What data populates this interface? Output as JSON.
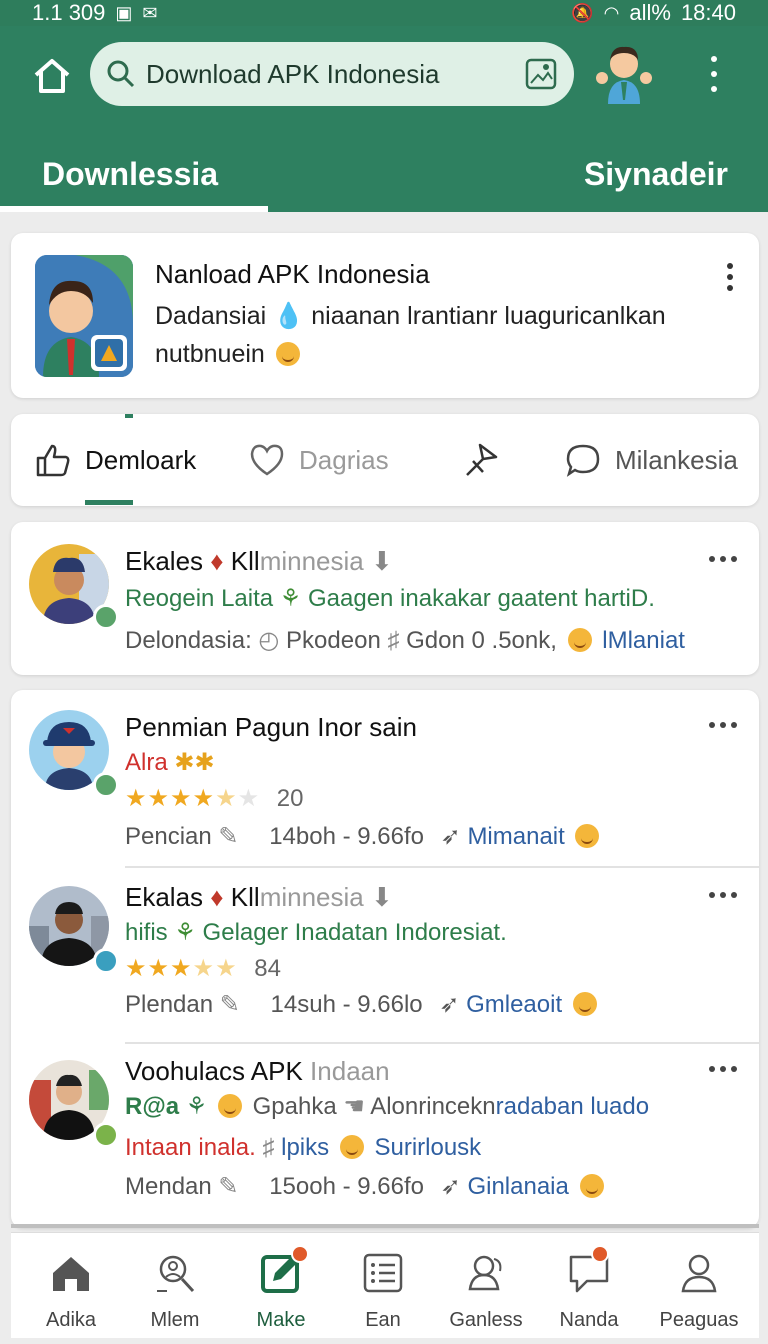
{
  "status_bar": {
    "left_text": "1.1 309",
    "time": "18:40",
    "signal_label": "all%"
  },
  "header": {
    "search_value": "Download APK Indonesia",
    "tabs": [
      {
        "label": "Downlessia",
        "active": true
      },
      {
        "label": "Siynadeir",
        "active": false
      }
    ]
  },
  "featured": {
    "title": "Nanload APK Indonesia",
    "desc_line1": "Dadansiai",
    "desc_line1b": "niaanan lrantianr luaguricanlkan",
    "desc_line2": "nutbnuein"
  },
  "actions": [
    {
      "label": "Demloark",
      "icon": "thumb-up-icon",
      "active": true
    },
    {
      "label": "Dagrias",
      "icon": "heart-icon",
      "active": false
    },
    {
      "label": "",
      "icon": "share-icon",
      "active": false
    },
    {
      "label": "Milankesia",
      "icon": "comment-icon",
      "active": false
    }
  ],
  "posts": [
    {
      "title_main": "Ekales",
      "title_after": "Kll",
      "title_faded": "minnesia",
      "line1": "Reogein Laita",
      "line1b": "Gaagen inakakar gaatent hartiD.",
      "line3": "Delondasia:",
      "line3b": "Pkodeon",
      "line3c": "Gdon 0 .5onk,",
      "line3d": "lMlaniat"
    },
    {
      "title_main": "Penmian Pagun Inor sain",
      "line1": "Alra",
      "rating": 4.5,
      "rating_count": "20",
      "meta_left": "Pencian",
      "meta_mid": "14boh - 9.66fo",
      "meta_link": "Mimanait"
    },
    {
      "title_main": "Ekalas",
      "title_after": "Kll",
      "title_faded": "minnesia",
      "line1": "hifis",
      "line1b": "Gelager Inadatan Indoresiat.",
      "rating": 3.5,
      "rating_count": "84",
      "meta_left": "Plendan",
      "meta_mid": "14suh - 9.66lo",
      "meta_link": "Gmleaoit"
    },
    {
      "title_main": "Voohulacs APK",
      "title_faded": "Indaan",
      "line1": "R@a",
      "line1b": "Gpahka",
      "line1c": "Alonrincekn",
      "line1d": "radaban luado",
      "line2": "Intaan inala.",
      "line2b": "lpiks",
      "line2c": "Surirlousk",
      "meta_left": "Mendan",
      "meta_mid": "15ooh - 9.66fo",
      "meta_link": "Ginlanaia"
    }
  ],
  "bottom_nav": [
    {
      "label": "Adika",
      "icon": "home-icon",
      "active": false
    },
    {
      "label": "Mlem",
      "icon": "search-person-icon",
      "active": false
    },
    {
      "label": "Make",
      "icon": "edit-icon",
      "active": true
    },
    {
      "label": "Ean",
      "icon": "list-icon",
      "active": false
    },
    {
      "label": "Ganless",
      "icon": "people-icon",
      "active": false
    },
    {
      "label": "Nanda",
      "icon": "chat-icon",
      "active": false
    },
    {
      "label": "Peaguas",
      "icon": "profile-icon",
      "active": false
    }
  ],
  "colors": {
    "brand": "#2e8060",
    "accent_green": "#2e7d4a",
    "link_blue": "#2f5fa0",
    "alert_red": "#d0312d",
    "star": "#f0a820"
  }
}
